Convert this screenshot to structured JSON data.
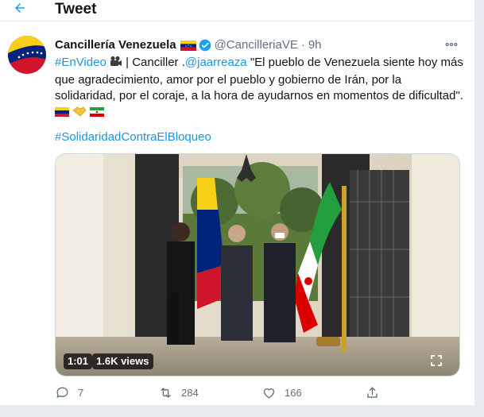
{
  "header": {
    "title": "Tweet"
  },
  "tweet": {
    "author_name": "Cancillería Venezuela",
    "handle": "@CancilleriaVE",
    "separator": "·",
    "time": "9h",
    "body": {
      "hashtag1": "#EnVideo",
      "text1": " | Canciller .",
      "mention": "@jaarreaza",
      "text2": " \"El pueblo de Venezuela siente hoy más que agradecimiento, amor por el pueblo y gobierno de Irán, por la solidaridad, por el coraje, a la hora de ayudarnos en momentos de dificultad\". "
    },
    "hashtag2": "#SolidaridadContraElBloqueo",
    "video": {
      "duration": "1:01",
      "views": "1.6K views"
    },
    "actions": {
      "replies": "7",
      "retweets": "284",
      "likes": "166"
    }
  },
  "colors": {
    "accent": "#1b95e0",
    "secondary_text": "#5b7083",
    "verified": "#1da1f2"
  }
}
